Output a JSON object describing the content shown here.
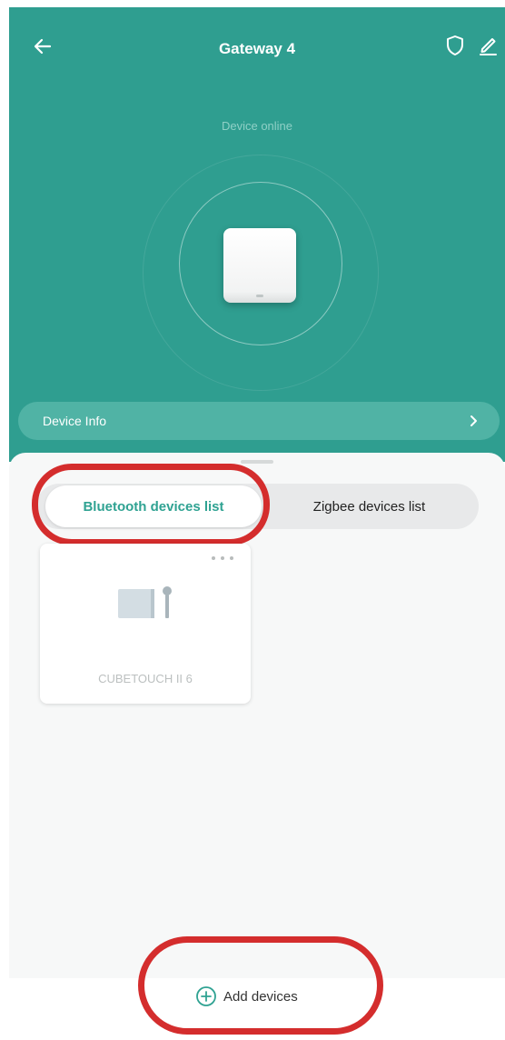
{
  "header": {
    "title": "Gateway 4",
    "status_text": "Device online"
  },
  "device_info": {
    "label": "Device Info"
  },
  "tabs": [
    {
      "label": "Bluetooth devices list",
      "selected": true
    },
    {
      "label": "Zigbee devices list",
      "selected": false
    }
  ],
  "device_cards": [
    {
      "name": "CUBETOUCH II 6"
    }
  ],
  "footer": {
    "add_label": "Add devices"
  },
  "colors": {
    "header_bg": "#2f9e90",
    "accent": "#2fa292",
    "highlight": "#d42d2d"
  },
  "icons": [
    "back-arrow-icon",
    "shield-icon",
    "edit-icon",
    "chevron-right-icon",
    "more-dots-icon",
    "plus-circle-icon"
  ]
}
